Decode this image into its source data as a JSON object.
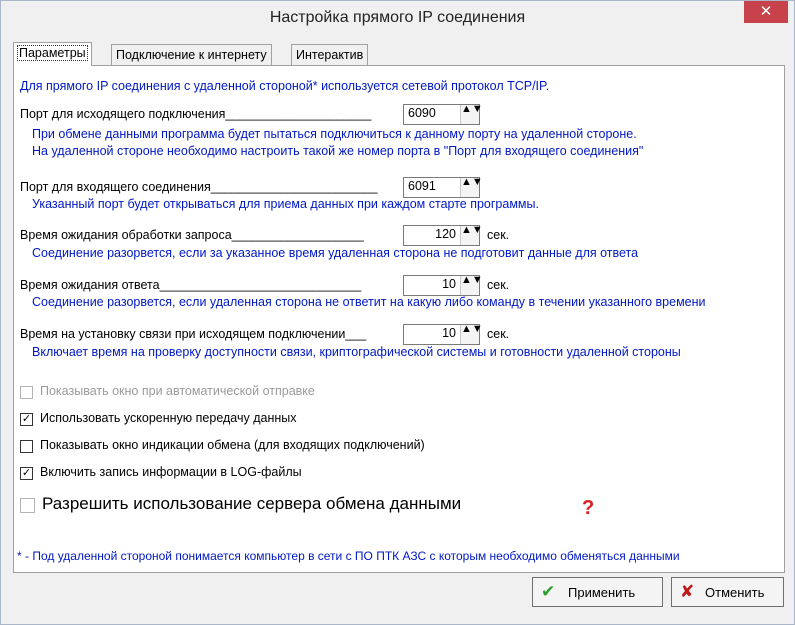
{
  "window": {
    "title": "Настройка прямого IP соединения",
    "close_icon": "✕"
  },
  "tabs": [
    {
      "label": "Параметры",
      "active": true
    },
    {
      "label": "Подключение к интернету",
      "active": false
    },
    {
      "label": "Интерактив",
      "active": false
    }
  ],
  "intro": "Для прямого IP соединения с удаленной стороной* используется сетевой протокол TCP/IP.",
  "fields": {
    "out_port": {
      "label": "Порт для исходящего подключения_____________________",
      "value": "6090",
      "desc1": "При обмене данными программа будет пытаться подключиться к данному порту на удаленной стороне.",
      "desc2": "На удаленной стороне необходимо настроить такой же номер порта в \"Порт для входящего соединения\""
    },
    "in_port": {
      "label": "Порт для входящего соединения________________________",
      "value": "6091",
      "desc1": "Указанный порт будет открываться для приема данных при каждом старте программы."
    },
    "request_timeout": {
      "label": "Время ожидания обработки запроса___________________",
      "value": "120",
      "unit": "сек.",
      "desc1": "Соединение разорвется, если за указанное время удаленная сторона не подготовит данные для ответа"
    },
    "response_timeout": {
      "label": "Время ожидания ответа_____________________________",
      "value": "10",
      "unit": "сек.",
      "desc1": "Соединение разорвется, если удаленная сторона не ответит на какую либо команду в течении указанного времени"
    },
    "connect_timeout": {
      "label": "Время на установку связи при исходящем подключении___",
      "value": "10",
      "unit": "сек.",
      "desc1": "Включает время на проверку доступности связи, криптографической системы и готовности удаленной стороны"
    }
  },
  "spin_arrows": "▲▼",
  "checkboxes": [
    {
      "label": "Показывать окно при автоматической отправке",
      "checked": false,
      "disabled": true
    },
    {
      "label": "Использовать ускоренную передачу данных",
      "checked": true,
      "disabled": false
    },
    {
      "label": "Показывать окно индикации обмена (для входящих подключений)",
      "checked": false,
      "disabled": false
    },
    {
      "label": "Включить запись информации в LOG-файлы",
      "checked": true,
      "disabled": false
    },
    {
      "label": "Разрешить использование сервера обмена данными",
      "checked": false,
      "disabled": false
    }
  ],
  "check_mark": "✓",
  "help_mark": "?",
  "footnote": "* - Под удаленной стороной понимается компьютер в сети с ПО ПТК АЗС с которым необходимо обменяться данными",
  "buttons": {
    "apply": {
      "label": "Применить",
      "icon": "✔"
    },
    "cancel": {
      "label": "Отменить",
      "icon": "✘"
    }
  },
  "colors": {
    "accent_blue": "#0018c4",
    "help_red": "#e02020",
    "apply_green": "#2e9e2e",
    "cancel_red": "#c01818",
    "close_red": "#c7424b"
  }
}
